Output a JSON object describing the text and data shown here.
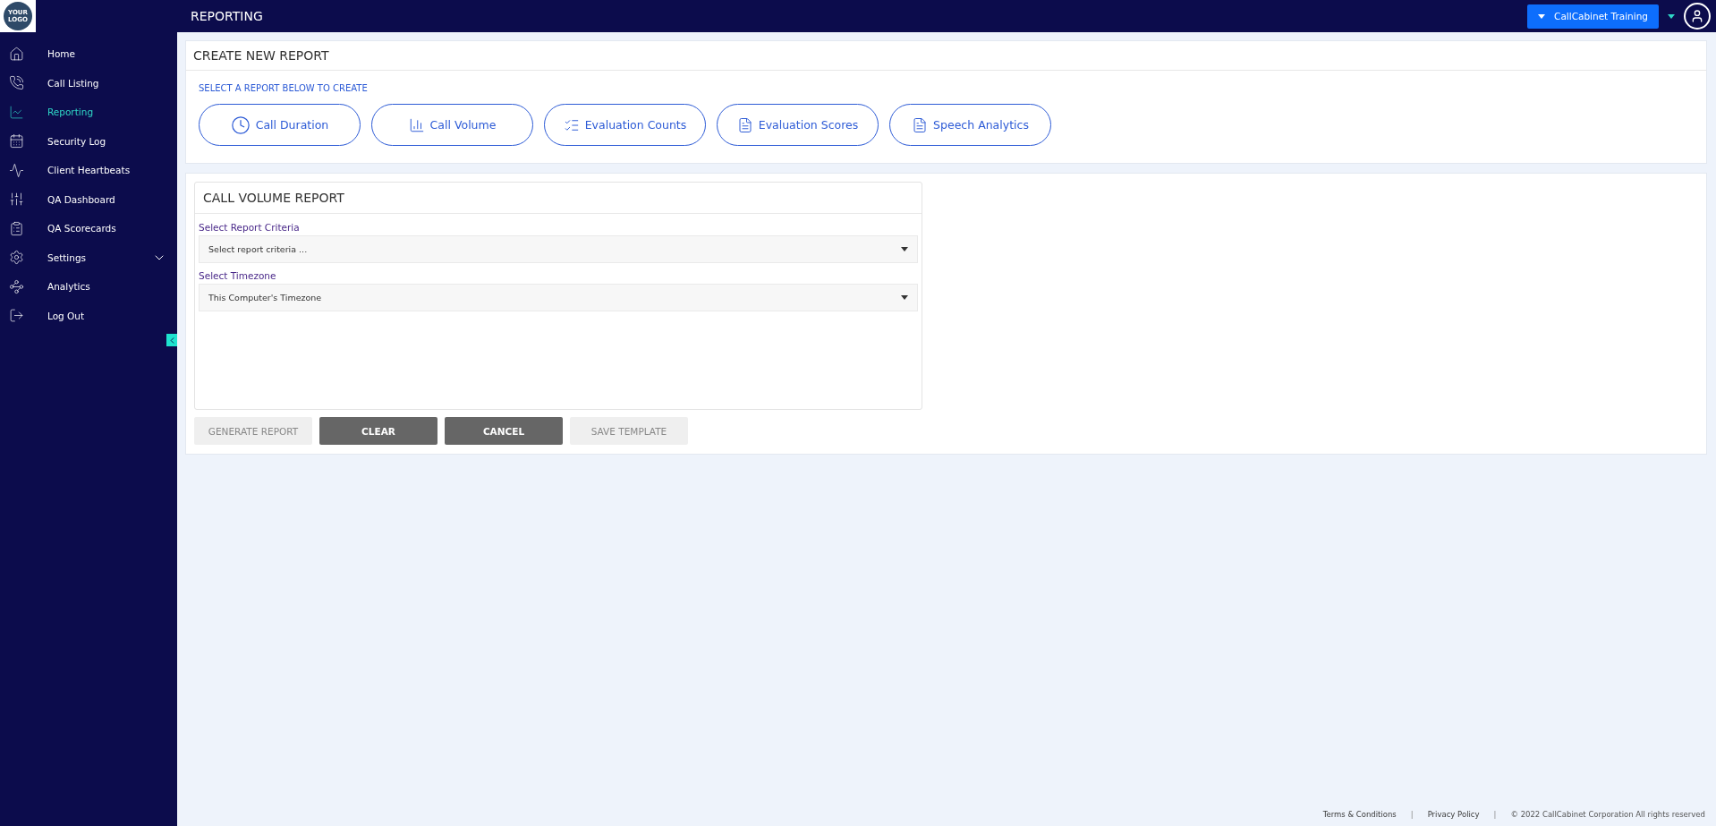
{
  "logo": {
    "line_1": "YOUR",
    "line_2": "LOGO"
  },
  "header": {
    "title": "REPORTING",
    "account_button": "CallCabinet Training"
  },
  "sidebar": {
    "items": [
      {
        "label": "Home",
        "selected": false
      },
      {
        "label": "Call Listing",
        "selected": false
      },
      {
        "label": "Reporting",
        "selected": true
      },
      {
        "label": "Security Log",
        "selected": false
      },
      {
        "label": "Client Heartbeats",
        "selected": false
      },
      {
        "label": "QA Dashboard",
        "selected": false
      },
      {
        "label": "QA Scorecards",
        "selected": false
      },
      {
        "label": "Settings",
        "selected": false,
        "expanded": false
      },
      {
        "label": "Analytics",
        "selected": false
      },
      {
        "label": "Log Out",
        "selected": false
      }
    ]
  },
  "create_card": {
    "title": "CREATE NEW REPORT",
    "subtitle": "SELECT A REPORT BELOW TO CREATE",
    "report_types": [
      {
        "label": "Call Duration"
      },
      {
        "label": "Call Volume"
      },
      {
        "label": "Evaluation Counts"
      },
      {
        "label": "Evaluation Scores"
      },
      {
        "label": "Speech Analytics"
      }
    ]
  },
  "report_panel": {
    "title": "CALL VOLUME REPORT",
    "fields": [
      {
        "label": "Select Report Criteria",
        "placeholder": "Select report criteria ..."
      },
      {
        "label": "Select Timezone",
        "value": "This Computer's Timezone"
      }
    ],
    "buttons": [
      {
        "label": "GENERATE REPORT",
        "disabled": true
      },
      {
        "label": "CLEAR",
        "disabled": false
      },
      {
        "label": "CANCEL",
        "disabled": false
      },
      {
        "label": "SAVE TEMPLATE",
        "disabled": true
      }
    ]
  },
  "footer": [
    {
      "kind": "link",
      "text": "Terms & Conditions"
    },
    {
      "kind": "separator",
      "text": "|"
    },
    {
      "kind": "link",
      "text": "Privacy Policy"
    },
    {
      "kind": "separator",
      "text": "|"
    },
    {
      "kind": "copyright",
      "text": "© 2022 CallCabinet Corporation All rights reserved"
    }
  ]
}
